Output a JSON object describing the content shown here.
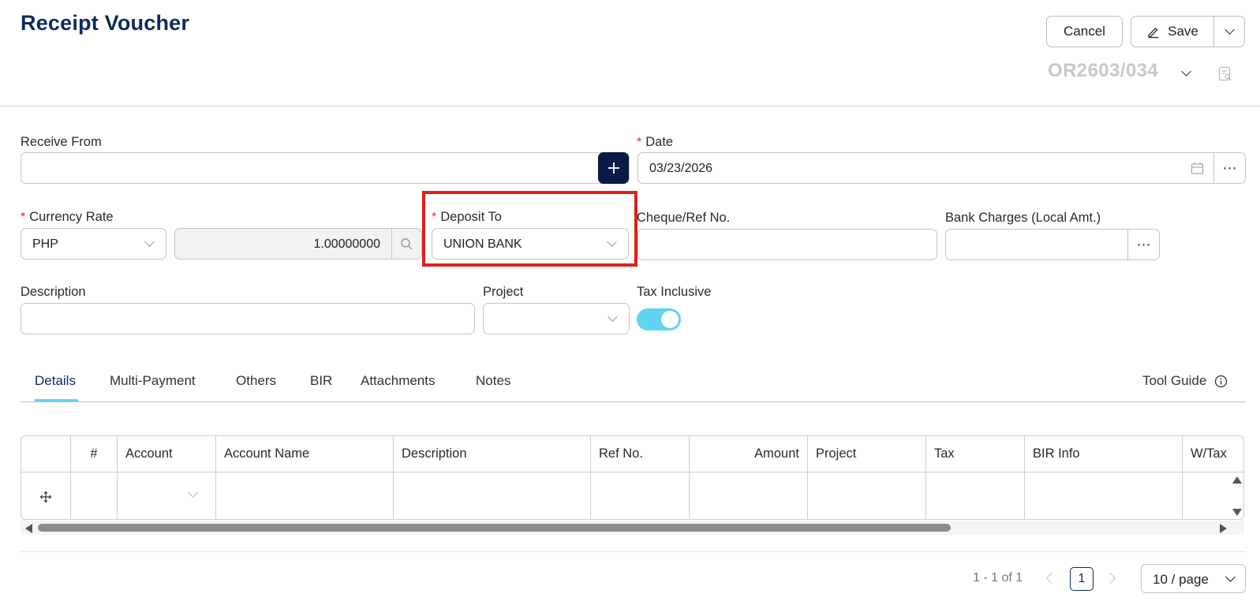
{
  "header": {
    "title": "Receipt Voucher",
    "cancel_label": "Cancel",
    "save_label": "Save",
    "doc_number": "OR2603/034"
  },
  "form": {
    "receive_from": {
      "label": "Receive From",
      "value": ""
    },
    "date": {
      "label": "Date",
      "value": "03/23/2026",
      "required": true
    },
    "currency_rate": {
      "label": "Currency Rate",
      "currency": "PHP",
      "rate": "1.00000000",
      "required": true
    },
    "deposit_to": {
      "label": "Deposit To",
      "value": "UNION BANK",
      "required": true
    },
    "cheque_ref": {
      "label": "Cheque/Ref No.",
      "value": ""
    },
    "bank_charges": {
      "label": "Bank Charges (Local Amt.)",
      "value": ""
    },
    "description": {
      "label": "Description",
      "value": ""
    },
    "project": {
      "label": "Project",
      "value": ""
    },
    "tax_inclusive": {
      "label": "Tax Inclusive",
      "on": true
    }
  },
  "tabs": [
    "Details",
    "Multi-Payment",
    "Others",
    "BIR",
    "Attachments",
    "Notes"
  ],
  "active_tab": "Details",
  "tool_guide_label": "Tool Guide",
  "table": {
    "columns": [
      "#",
      "Account",
      "Account Name",
      "Description",
      "Ref No.",
      "Amount",
      "Project",
      "Tax",
      "BIR Info",
      "W/Tax"
    ]
  },
  "pagination": {
    "range_text": "1 - 1 of 1",
    "current_page": "1",
    "page_size": "10 / page"
  },
  "colors": {
    "title": "#0e2a5e",
    "required": "#e02a2a",
    "toggle_on": "#5fd5f2",
    "highlight": "#e01e1e",
    "add_button": "#0b1a45"
  }
}
